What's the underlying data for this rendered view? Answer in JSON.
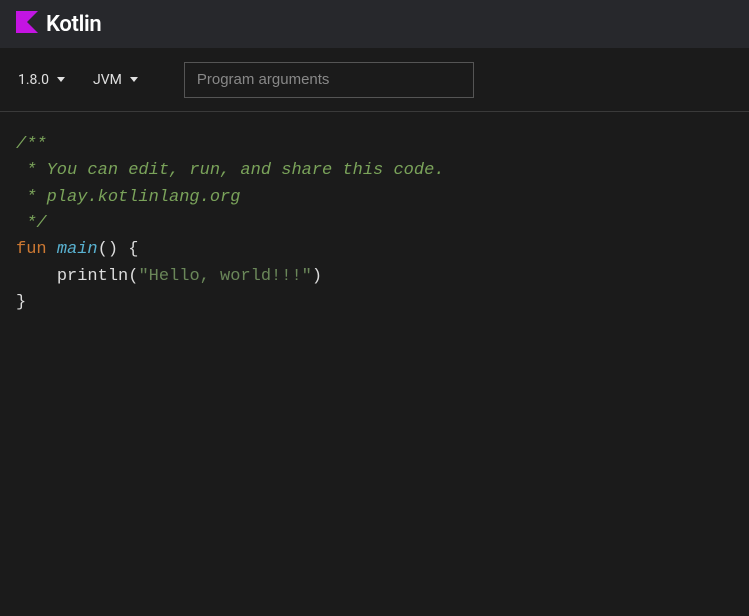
{
  "header": {
    "brand": "Kotlin"
  },
  "toolbar": {
    "version_label": "1.8.0",
    "target_label": "JVM",
    "args_placeholder": "Program arguments"
  },
  "code": {
    "line1": "/**",
    "line2": " * You can edit, run, and share this code.",
    "line3": " * play.kotlinlang.org",
    "line4": " */",
    "keyword_fun": "fun",
    "func_name": "main",
    "func_parens_brace": "() {",
    "indent": "    ",
    "println_call": "println",
    "open_paren": "(",
    "string_literal": "\"Hello, world!!!\"",
    "close_paren": ")",
    "closing_brace": "}"
  }
}
